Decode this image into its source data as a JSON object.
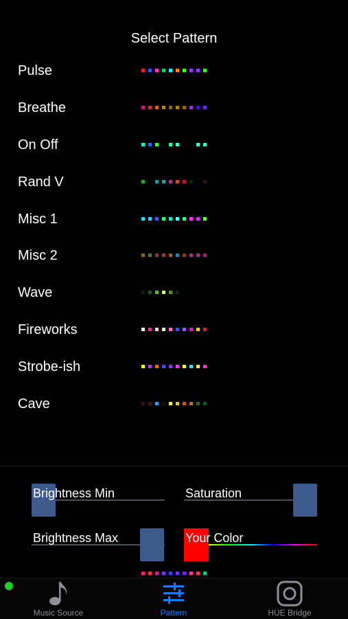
{
  "header": {
    "title": "Select Pattern"
  },
  "patterns": [
    {
      "label": "Pulse",
      "dots": [
        "#ff1a1a",
        "#3355ff",
        "#ff33cc",
        "#22cc66",
        "#00ffff",
        "#ff8800",
        "#33ff33",
        "#aa33ff",
        "#9933ff",
        "#33ff33"
      ]
    },
    {
      "label": "Breathe",
      "dots": [
        "#cc1177",
        "#cc3322",
        "#cc6622",
        "#aa8822",
        "#886622",
        "#aa8800",
        "#996600",
        "#9933cc",
        "#4411cc",
        "#6633dd"
      ]
    },
    {
      "label": "On Off",
      "dots": [
        "#00ffcc",
        "#3366ff",
        "#33ff33",
        "",
        "#33ff99",
        "#33ffcc",
        "",
        "",
        "#33ffcc",
        "#33ffcc"
      ]
    },
    {
      "label": "Rand V",
      "dots": [
        "#22aa22",
        "",
        "#229999",
        "#3399aa",
        "#aa3388",
        "#cc5522",
        "#aa2222",
        "#112211",
        "",
        "#331111"
      ]
    },
    {
      "label": "Misc 1",
      "dots": [
        "#22ddff",
        "#33ccff",
        "#5555ff",
        "#22ff66",
        "#00ffcc",
        "#55ffff",
        "#33ff77",
        "#ff33ff",
        "#cc33ff",
        "#66ff33"
      ]
    },
    {
      "label": "Misc 2",
      "dots": [
        "#886622",
        "#557722",
        "#883355",
        "#aa3333",
        "#886622",
        "#228899",
        "#993322",
        "#aa3377",
        "#993388",
        "#aa2266"
      ]
    },
    {
      "label": "Wave",
      "dots": [
        "#112211",
        "#225522",
        "#66bb22",
        "#ccff66",
        "#449922",
        "#112211",
        "",
        "",
        "",
        ""
      ]
    },
    {
      "label": "Fireworks",
      "dots": [
        "#ffffff",
        "#ff2288",
        "#ffcccc",
        "#ddffaa",
        "#ff66cc",
        "#3355ff",
        "#9955ff",
        "#dd11cc",
        "#ffcc00",
        "#cc2222"
      ]
    },
    {
      "label": "Strobe-ish",
      "dots": [
        "#ffff00",
        "#aa33ff",
        "#ff6600",
        "#3355ff",
        "#8833ff",
        "#ff33ff",
        "#ffff33",
        "#33ddff",
        "#ffee33",
        "#ff33cc"
      ]
    },
    {
      "label": "Cave",
      "dots": [
        "#331122",
        "#441122",
        "#3399ff",
        "#111111",
        "#ffee33",
        "#ddcc33",
        "#cc5522",
        "#aa7722",
        "#226622",
        "#115522"
      ]
    }
  ],
  "controls": {
    "brightness_min": {
      "label": "Brightness Min",
      "value": 0.0
    },
    "saturation": {
      "label": "Saturation",
      "value": 1.0
    },
    "brightness_max": {
      "label": "Brightness Max",
      "value": 1.0
    },
    "your_color": {
      "label": "Your Color",
      "value": 0.0,
      "color": "#ff0000"
    }
  },
  "preview_dots": [
    "#ff2266",
    "#ff3333",
    "#cc2288",
    "#7733ff",
    "#3344ff",
    "#6633ff",
    "#7722ee",
    "#ff33aa",
    "#ff3355",
    "#11cc88"
  ],
  "tabs": [
    {
      "label": "Music Source",
      "icon": "music-note-icon",
      "active": false
    },
    {
      "label": "Pattern",
      "icon": "sliders-icon",
      "active": true
    },
    {
      "label": "HUE Bridge",
      "icon": "instagram-icon",
      "active": false
    }
  ],
  "status": {
    "connected_color": "#22cc22"
  },
  "colors": {
    "accent": "#1a7cff",
    "inactive": "#8e8e93",
    "thumb": "#3d5a8c"
  }
}
